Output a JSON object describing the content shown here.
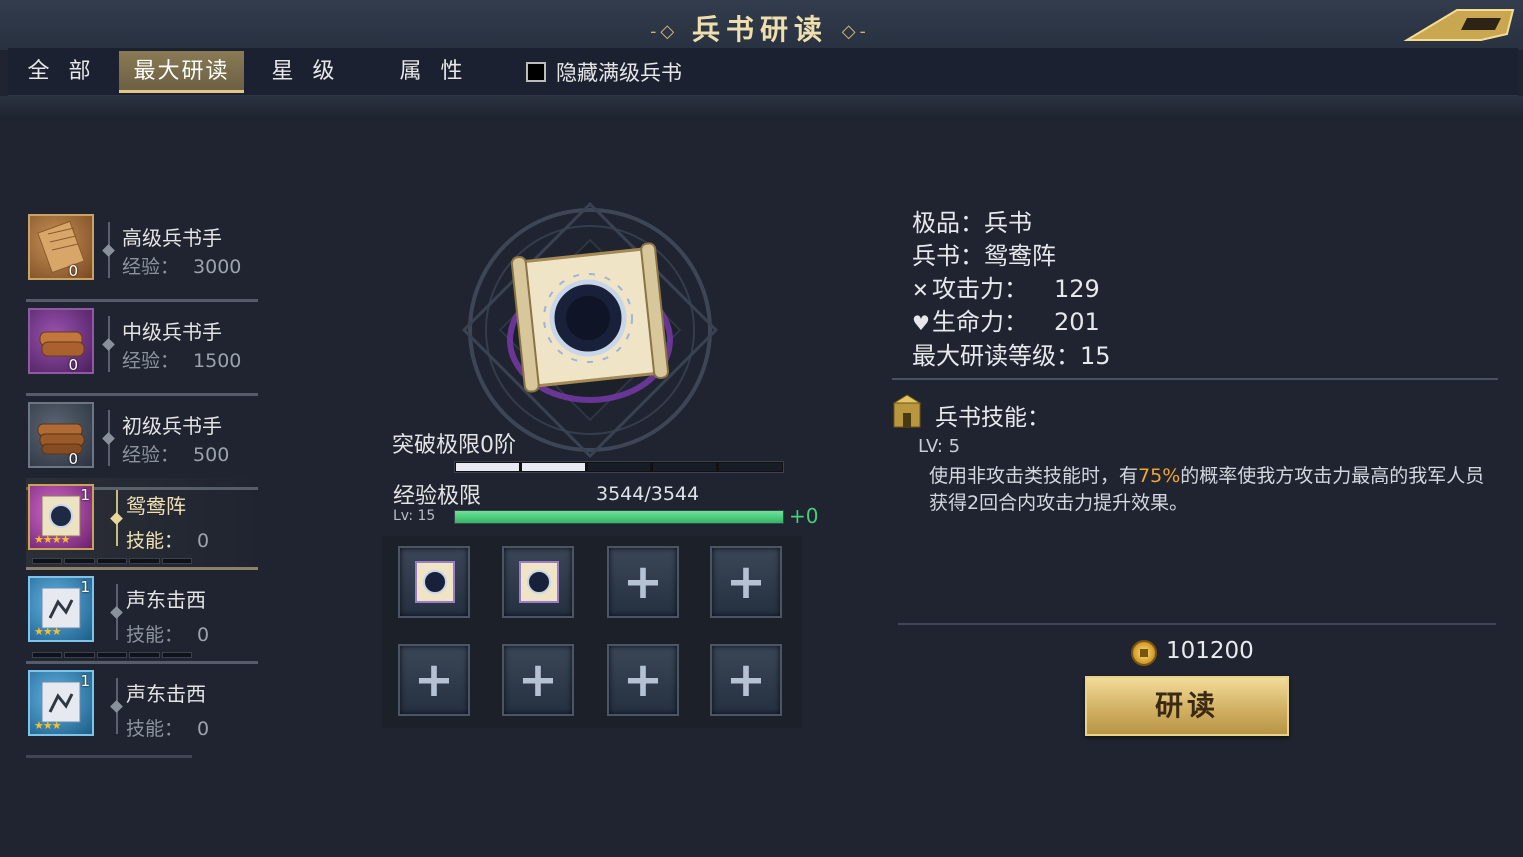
{
  "header": {
    "title": "兵书研读"
  },
  "tabs": [
    {
      "label": "全 部",
      "active": false
    },
    {
      "label": "最大研读",
      "active": true
    },
    {
      "label": "星 级",
      "active": false
    },
    {
      "label": "属 性",
      "active": false
    }
  ],
  "filter": {
    "hide_full_label": "隐藏满级兵书",
    "checked": false
  },
  "book_list": [
    {
      "name": "高级兵书手",
      "sub_label": "经验：",
      "sub_value": "3000",
      "count": "0",
      "style": "gold"
    },
    {
      "name": "中级兵书手",
      "sub_label": "经验：",
      "sub_value": "1500",
      "count": "0",
      "style": "purple"
    },
    {
      "name": "初级兵书手",
      "sub_label": "经验：",
      "sub_value": "500",
      "count": "0",
      "style": "gray"
    },
    {
      "name": "鸳鸯阵",
      "sub_label": "技能：",
      "sub_value": "0",
      "count": "1",
      "stars": 4,
      "style": "pink",
      "selected": true
    },
    {
      "name": "声东击西",
      "sub_label": "技能：",
      "sub_value": "0",
      "count": "1",
      "stars": 3,
      "style": "blue"
    },
    {
      "name": "声东击西",
      "sub_label": "技能：",
      "sub_value": "0",
      "count": "1",
      "stars": 3,
      "style": "blue"
    }
  ],
  "center": {
    "break_label": "突破极限0阶",
    "break_filled": 2,
    "break_segments": 5,
    "exp_label": "经验极限",
    "exp_text": "3544/3544",
    "lv_label": "Lv: 15",
    "exp_fraction": 1.0,
    "exp_plus": "+0"
  },
  "slots": [
    {
      "type": "scroll"
    },
    {
      "type": "scroll"
    },
    {
      "type": "empty",
      "label": "+"
    },
    {
      "type": "empty",
      "label": "+"
    },
    {
      "type": "empty",
      "label": "+"
    },
    {
      "type": "empty",
      "label": "+"
    },
    {
      "type": "empty",
      "label": "+"
    },
    {
      "type": "empty",
      "label": "+"
    }
  ],
  "info": {
    "quality": "极品：兵书",
    "book": "兵书：鸳鸯阵",
    "attack_label": "攻击力：",
    "attack_value": "129",
    "hp_label": "生命力：",
    "hp_value": "201",
    "max_level": "最大研读等级：15"
  },
  "skill": {
    "title": "兵书技能：",
    "lv": "LV: 5",
    "desc_pre": "使用非攻击类技能时，有",
    "desc_hl": "75%",
    "desc_post": "的概率使我方攻击力最高的我军人员获得2回合内攻击力提升效果。"
  },
  "cost": {
    "amount": "101200"
  },
  "action": {
    "read_label": "研读"
  },
  "colors": {
    "accent": "#e0c985",
    "highlight": "#f0a630",
    "exp_green": "#43d07a"
  }
}
